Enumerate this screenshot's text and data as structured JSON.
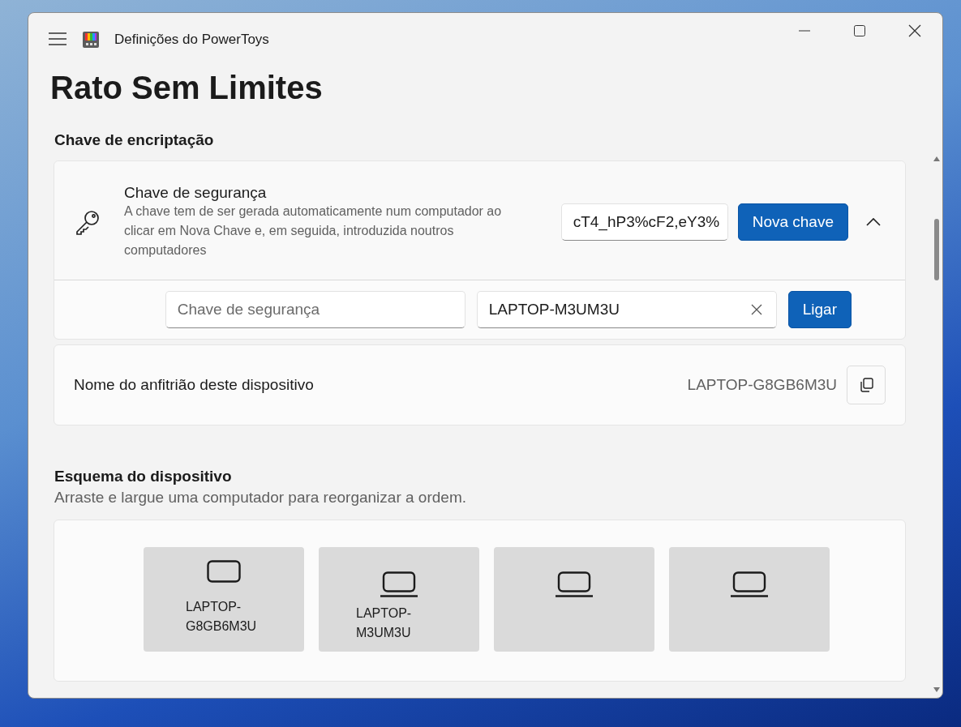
{
  "window": {
    "title": "Definições do PowerToys"
  },
  "page_title": "Rato Sem Limites",
  "encryption": {
    "heading": "Chave de encriptação",
    "security_key": {
      "title": "Chave de segurança",
      "description": "A chave tem de ser gerada automaticamente num computador ao clicar em Nova Chave e, em seguida, introduzida noutros computadores",
      "value": "cT4_hP3%cF2,eY3%",
      "new_key_button": "Nova chave",
      "expanded": true
    },
    "connect": {
      "key_placeholder": "Chave de segurança",
      "host_value": "LAPTOP-M3UM3U",
      "connect_button": "Ligar"
    },
    "hostname": {
      "label": "Nome do anfitrião deste dispositivo",
      "value": "LAPTOP-G8GB6M3U"
    }
  },
  "layout": {
    "heading": "Esquema do dispositivo",
    "description": "Arraste e largue uma computador para reorganizar a ordem.",
    "devices": [
      {
        "kind": "display",
        "name": "LAPTOP-\nG8GB6M3U"
      },
      {
        "kind": "laptop",
        "name": "LAPTOP-\nM3UM3U"
      },
      {
        "kind": "laptop"
      },
      {
        "kind": "laptop"
      }
    ]
  }
}
